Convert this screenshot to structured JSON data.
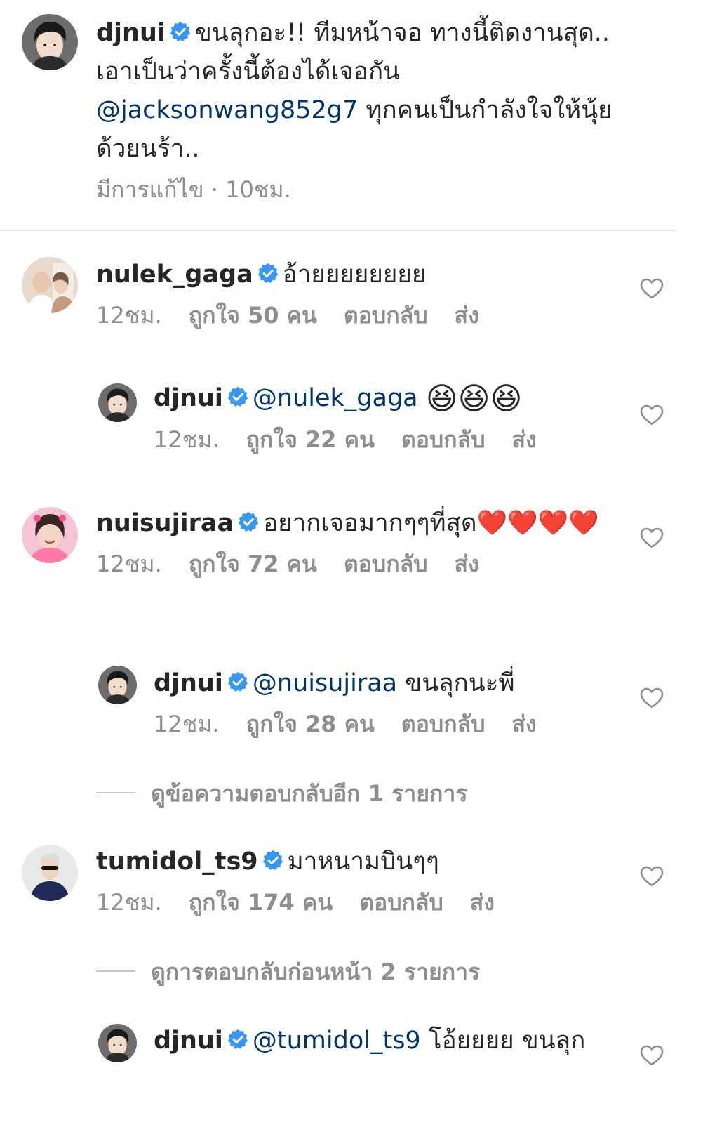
{
  "caption": {
    "username": "djnui",
    "text": "ขนลุกอะ!! ทีมหน้าจอ ทางนี้ติดงานสุด.. เอาเป็นว่าครั้งนี้ต้องได้เจอกัน ",
    "mention": "@jacksonwang852g7",
    "text_after": " ทุกคนเป็นกำลังใจให้นุ้ยด้วยนร้า..",
    "meta": "มีการแก้ไข · 10ชม."
  },
  "labels": {
    "reply": "ตอบกลับ",
    "send": "ส่ง"
  },
  "comments": [
    {
      "username": "nulek_gaga",
      "text": "อ้ายยยยยยยย",
      "time": "12ชม.",
      "likes": "ถูกใจ 50 คน"
    },
    {
      "username": "djnui",
      "mention": "@nulek_gaga",
      "text": "😆😆😆",
      "time": "12ชม.",
      "likes": "ถูกใจ 22 คน"
    },
    {
      "username": "nuisujiraa",
      "text": "อยากเจอมากๆๆที่สุด❤️❤️❤️❤️",
      "time": "12ชม.",
      "likes": "ถูกใจ 72 คน"
    },
    {
      "username": "djnui",
      "mention": "@nuisujiraa",
      "text": " ขนลุกนะพี่",
      "time": "12ชม.",
      "likes": "ถูกใจ 28 คน"
    },
    {
      "username": "tumidol_ts9",
      "text": "มาหนามบินๆๆ",
      "time": "12ชม.",
      "likes": "ถูกใจ 174 คน"
    },
    {
      "username": "djnui",
      "mention": "@tumidol_ts9",
      "text": " โอ้ยยยย ขนลุก"
    }
  ],
  "view_more_replies": "ดูข้อความตอบกลับอีก 1 รายการ",
  "view_previous_replies": "ดูการตอบกลับก่อนหน้า 2 รายการ",
  "colors": {
    "text": "#262626",
    "secondary": "#8e8e8e",
    "mention": "#00376b",
    "verified": "#3897f0"
  },
  "icons": {
    "verified": "verified-badge-icon",
    "heart": "heart-outline-icon"
  }
}
